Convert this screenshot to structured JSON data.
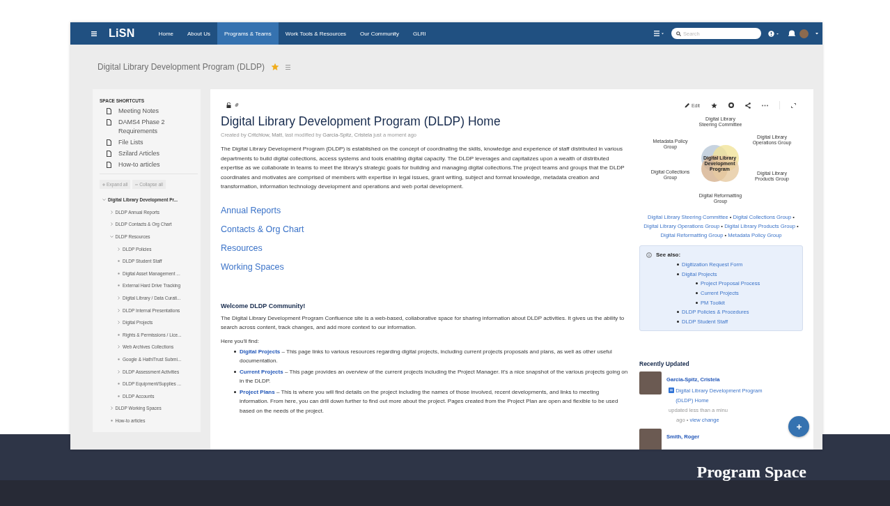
{
  "slide": {
    "caption": "Program Space"
  },
  "navbar": {
    "logo": "LiSN",
    "items": [
      {
        "label": "Home",
        "selected": false
      },
      {
        "label": "About Us",
        "selected": false
      },
      {
        "label": "Programs & Teams",
        "selected": true
      },
      {
        "label": "Work Tools & Resources",
        "selected": false
      },
      {
        "label": "Our Community",
        "selected": false
      },
      {
        "label": "GLRI",
        "selected": false
      }
    ],
    "search": {
      "placeholder": "Search"
    }
  },
  "space_header": {
    "title": "Digital Library Development Program (DLDP)",
    "favourite": true
  },
  "sidebar": {
    "shortcuts_heading": "SPACE SHORTCUTS",
    "shortcuts": [
      "Meeting Notes",
      "DAMS4 Phase 2 Requirements",
      "File Lists",
      "Szilard Articles",
      "How-to articles"
    ],
    "expand_all": "Expand all",
    "collapse_all": "Collapse all",
    "tree": [
      {
        "label": "Digital Library Development Pr...",
        "kind": "branch",
        "expanded": true,
        "children": [
          {
            "label": "DLDP Annual Reports",
            "kind": "branch",
            "expanded": false
          },
          {
            "label": "DLDP Contacts & Org Chart",
            "kind": "branch",
            "expanded": false
          },
          {
            "label": "DLDP Resources",
            "kind": "branch",
            "expanded": true,
            "children": [
              {
                "label": "DLDP Policies",
                "kind": "branch",
                "expanded": false
              },
              {
                "label": "DLDP Student Staff",
                "kind": "leaf"
              },
              {
                "label": "Digital Asset Management ...",
                "kind": "leaf"
              },
              {
                "label": "External Hard Drive Tracking",
                "kind": "leaf"
              },
              {
                "label": "Digital Library / Data Curati...",
                "kind": "branch",
                "expanded": false
              },
              {
                "label": "DLDP Internal Presentations",
                "kind": "branch",
                "expanded": false
              },
              {
                "label": "Digital Projects",
                "kind": "branch",
                "expanded": false
              },
              {
                "label": "Rights & Permissions / Lice...",
                "kind": "leaf"
              },
              {
                "label": "Web Archives Collections",
                "kind": "branch",
                "expanded": false
              },
              {
                "label": "Google & HathiTrust Submi...",
                "kind": "leaf"
              },
              {
                "label": "DLDP Assessment Activities",
                "kind": "branch",
                "expanded": false
              },
              {
                "label": "DLDP Equipment/Supplies ...",
                "kind": "leaf"
              },
              {
                "label": "DLDP Accounts",
                "kind": "leaf"
              }
            ]
          },
          {
            "label": "DLDP Working Spaces",
            "kind": "branch",
            "expanded": false
          },
          {
            "label": "How-to articles",
            "kind": "leaf"
          }
        ]
      }
    ]
  },
  "toolbar": {
    "edit": "Edit"
  },
  "page": {
    "title": "Digital Library Development Program (DLDP) Home",
    "byline": {
      "prefix": "Created by",
      "creator": "Critchlow, Matt",
      "middle": ", last modified by",
      "modifier": "Garcia-Spitz, Cristela",
      "suffix": "just a moment ago"
    },
    "intro": "The Digital Library Development Program (DLDP) is established on the concept of coordinating the skills, knowledge and experience of staff distributed in various departments to build digital collections, access systems and tools enabling digital capacity. The DLDP leverages and capitalizes upon a wealth of distributed expertise as we collaborate in teams to meet the library's strategic goals for building and managing digital collections.The project teams and groups that the DLDP coordinates and motivates are comprised of members with expertise in legal issues, grant writing, subject and format knowledge, metadata creation and transformation, information technology development and operations and web portal development.",
    "section_links": [
      "Annual Reports",
      "Contacts & Org Chart",
      "Resources",
      "Working Spaces"
    ],
    "welcome": {
      "heading": "Welcome DLDP Community!",
      "text": "The Digital Library Development Program Confluence site is a web-based, collaborative space for sharing information about DLDP activities. It gives us the ability to search across content, track changes, and add more context to our information.",
      "lead": "Here you'll find:",
      "items": [
        {
          "link": "Digital Projects",
          "text": "– This page links to various resources regarding digital projects, including current projects proposals and plans, as well as other useful documentation."
        },
        {
          "link": "Current Projects",
          "text": "– This page provides an overview of the current projects including the Project Manager. It's a nice snapshot of the various projects going on in the DLDP."
        },
        {
          "link": "Project Plans",
          "text": "– This is where you will find details on the project including the names of those involved, recent developments, and links to meeting information. From here, you can drill down further to find out more about the project. Pages created from the Project Plan are open and flexible to be used based on the needs of the project."
        }
      ]
    }
  },
  "aside": {
    "diagram": {
      "center": "Digital Library Development Program",
      "groups": [
        "Digital Library Steering Committee",
        "Digital Library Operations Group",
        "Metadata Policy Group",
        "Digital Collections Group",
        "Digital Library Products Group",
        "Digital Reformatting Group"
      ]
    },
    "related_links": [
      "Digital Library Steering Committee",
      "Digital Collections Group",
      "Digital Library Operations Group",
      "Digital Library Products Group",
      "Digital Reformatting Group",
      "Metadata Policy Group"
    ],
    "separator": "•",
    "see_also": {
      "heading": "See also:",
      "items": [
        {
          "label": "Digitization Request Form"
        },
        {
          "label": "Digital Projects",
          "children": [
            {
              "label": "Project Proposal Process"
            },
            {
              "label": "Current Projects"
            },
            {
              "label": "PM Toolkit"
            }
          ]
        },
        {
          "label": "DLDP Policies & Procedures"
        },
        {
          "label": "DLDP Student Staff"
        }
      ]
    },
    "recently_updated": {
      "heading": "Recently Updated",
      "items": [
        {
          "name": "Garcia-Spitz, Cristela",
          "page": "Digital Library Development Program (DLDP) Home",
          "meta": "updated less than a minu",
          "tail": "ago",
          "separator": "•",
          "action": "view change"
        },
        {
          "name": "Smith, Roger"
        }
      ]
    }
  }
}
